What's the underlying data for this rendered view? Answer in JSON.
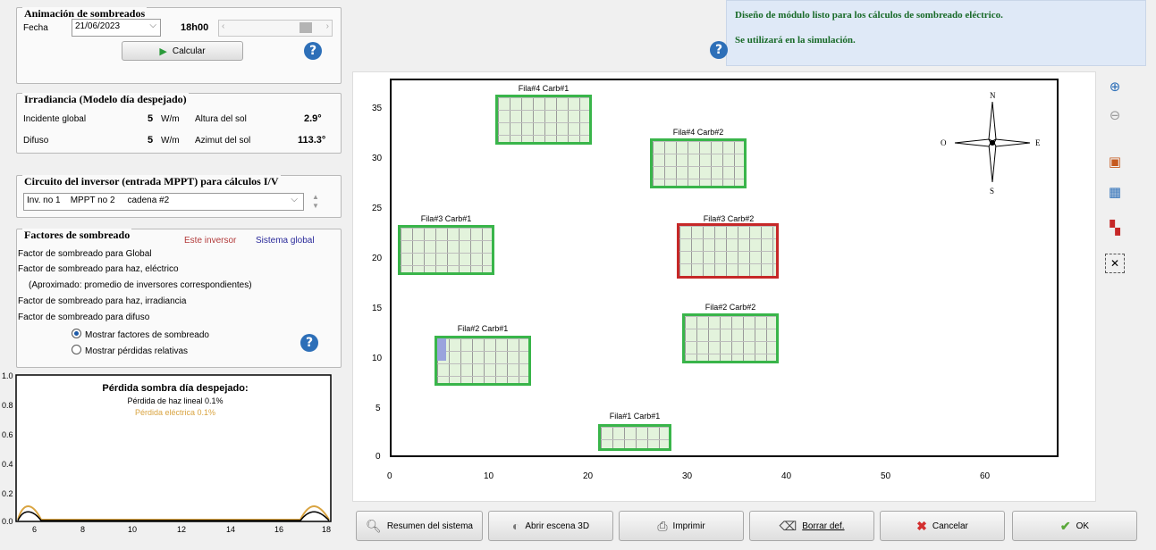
{
  "animation": {
    "title": "Animación de sombreados",
    "date_label": "Fecha",
    "date_value": "21/06/2023",
    "time_value": "18h00",
    "calc_button": "Calcular"
  },
  "irradiance": {
    "title": "Irradiancia (Modelo día despejado)",
    "global_label": "Incidente global",
    "global_value": "5",
    "global_unit": "W/m",
    "diffuse_label": "Difuso",
    "diffuse_value": "5",
    "diffuse_unit": "W/m",
    "height_label": "Altura del sol",
    "height_value": "2.9°",
    "azimuth_label": "Azimut del sol",
    "azimuth_value": "113.3°"
  },
  "inverter": {
    "title": "Circuito del inversor (entrada MPPT) para cálculos I/V",
    "selected": "Inv. no 1    MPPT no 2     cadena #2"
  },
  "shading": {
    "title": "Factores de sombreado",
    "col_inverter": "Este inversor",
    "col_global": "Sistema global",
    "line1": "Factor de sombreado para Global",
    "line2": "Factor de sombreado para haz,  eléctrico",
    "line3": "(Aproximado: promedio de inversores correspondientes)",
    "line4": "Factor de sombreado para haz,  irradiancia",
    "line5": "Factor de sombreado para difuso",
    "radio1": "Mostrar factores de sombreado",
    "radio2": "Mostrar pérdidas relativas"
  },
  "loss_chart": {
    "title": "Pérdida sombra día despejado:",
    "line_beam": "Pérdida de haz lineal 0.1%",
    "line_elec": "Pérdida eléctrica 0.1%",
    "y_ticks": [
      "1.0",
      "0.8",
      "0.6",
      "0.4",
      "0.2",
      "0.0"
    ],
    "x_ticks": [
      "6",
      "8",
      "10",
      "12",
      "14",
      "16",
      "18"
    ]
  },
  "info": {
    "line1": "Diseño de módulo listo para los cálculos de sombreado eléctrico.",
    "line2": "Se utilizará en la simulación."
  },
  "scene": {
    "y_ticks": [
      "35",
      "30",
      "25",
      "20",
      "15",
      "10",
      "5",
      "0"
    ],
    "x_ticks": [
      "0",
      "10",
      "20",
      "30",
      "40",
      "50",
      "60"
    ],
    "compass": {
      "n": "N",
      "s": "S",
      "e": "E",
      "o": "O"
    },
    "modules": [
      {
        "label": "Fila#4 Carb#1"
      },
      {
        "label": "Fila#4 Carb#2"
      },
      {
        "label": "Fila#3 Carb#1"
      },
      {
        "label": "Fila#3 Carb#2"
      },
      {
        "label": "Fila#2 Carb#2"
      },
      {
        "label": "Fila#2 Carb#1"
      },
      {
        "label": "Fila#1 Carb#1"
      }
    ]
  },
  "buttons": {
    "summary": "Resumen del sistema",
    "scene3d": "Abrir escena 3D",
    "print": "Imprimir",
    "delete": "Borrar def.",
    "cancel": "Cancelar",
    "ok": "OK"
  },
  "colors": {
    "accent": "#2d6fb8",
    "module_ok": "#39b54a",
    "module_selected": "#c62828",
    "beam_loss": "#000000",
    "elec_loss": "#d9a441"
  }
}
